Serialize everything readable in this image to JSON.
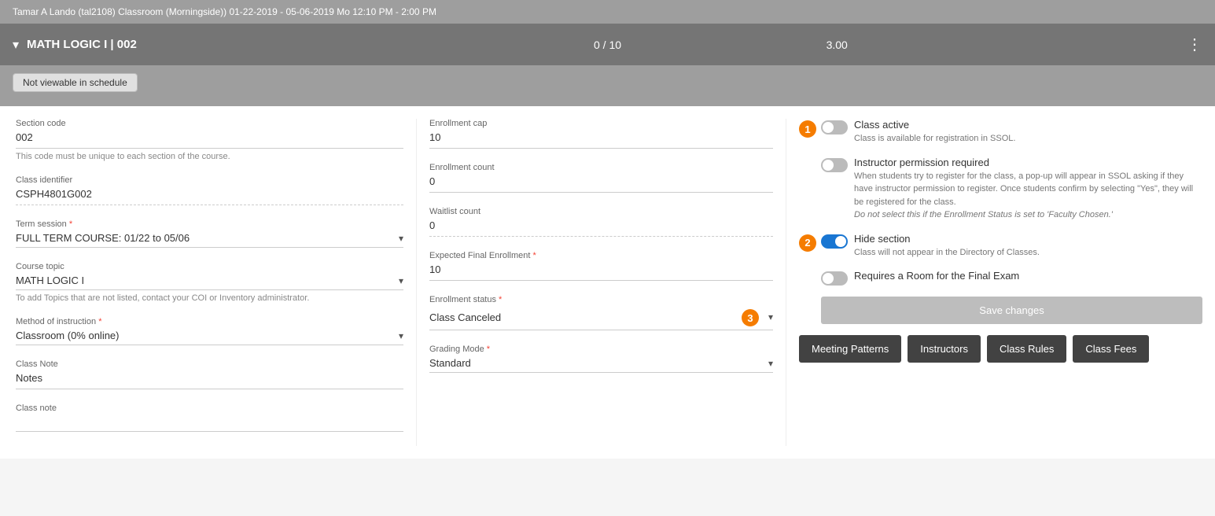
{
  "topRow": {
    "text": "Tamar A Lando (tal2108)     Classroom (Morningside))     01-22-2019 - 05-06-2019     Mo 12:10 PM - 2:00 PM"
  },
  "sectionHeader": {
    "title": "MATH LOGIC I | 002",
    "counts": "0 / 10",
    "credits": "3.00"
  },
  "badge": {
    "notViewable": "Not viewable in schedule"
  },
  "leftCol": {
    "sectionCode": {
      "label": "Section code",
      "value": "002",
      "hint": "This code must be unique to each section of the course."
    },
    "classIdentifier": {
      "label": "Class identifier",
      "value": "CSPH4801G002"
    },
    "termSession": {
      "label": "Term session",
      "required": true,
      "value": "FULL TERM COURSE: 01/22 to 05/06"
    },
    "courseTopic": {
      "label": "Course topic",
      "required": false,
      "value": "MATH LOGIC I",
      "hint": "To add Topics that are not listed, contact your COI or Inventory administrator."
    },
    "methodOfInstruction": {
      "label": "Method of instruction",
      "required": true,
      "value": "Classroom (0% online)"
    },
    "classNote": {
      "label": "Class Note",
      "value": "Notes"
    },
    "classNoteValue": {
      "label": "Class note",
      "value": ""
    }
  },
  "midCol": {
    "enrollmentCap": {
      "label": "Enrollment cap",
      "value": "10"
    },
    "enrollmentCount": {
      "label": "Enrollment count",
      "value": "0"
    },
    "waitlistCount": {
      "label": "Waitlist count",
      "value": "0"
    },
    "expectedFinalEnrollment": {
      "label": "Expected Final Enrollment",
      "required": true,
      "value": "10"
    },
    "enrollmentStatus": {
      "label": "Enrollment status",
      "required": true,
      "value": "Class Canceled",
      "badge": "3"
    },
    "gradingMode": {
      "label": "Grading Mode",
      "required": true,
      "value": "Standard"
    }
  },
  "rightCol": {
    "badge1": "1",
    "badge2": "2",
    "classActive": {
      "label": "Class active",
      "desc": "Class is available for registration in SSOL.",
      "on": false
    },
    "instructorPermission": {
      "label": "Instructor permission required",
      "desc": "When students try to register for the class, a pop-up will appear in SSOL asking if they have instructor permission to register. Once students confirm by selecting \"Yes\", they will be registered for the class.",
      "descItalic": "Do not select this if the Enrollment Status is set to 'Faculty Chosen.'",
      "on": false
    },
    "hideSection": {
      "label": "Hide section",
      "desc": "Class will not appear in the Directory of Classes.",
      "on": true
    },
    "requiresRoom": {
      "label": "Requires a Room for the Final Exam",
      "on": false
    },
    "saveBtn": "Save changes",
    "buttons": {
      "meetingPatterns": "Meeting Patterns",
      "instructors": "Instructors",
      "classRules": "Class Rules",
      "classFees": "Class Fees"
    }
  }
}
